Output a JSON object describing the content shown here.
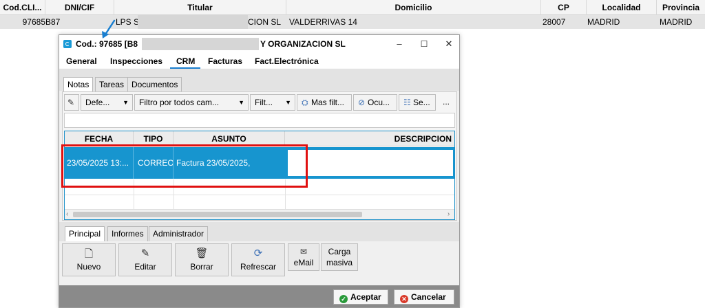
{
  "background": {
    "columns": [
      "Cod.CLI...",
      "DNI/CIF",
      "Titular",
      "Domicilio",
      "CP",
      "Localidad",
      "Provincia"
    ],
    "row": {
      "cod": "97685",
      "dni": "B87",
      "titular_left": "LPS S",
      "titular_right": "CION SL",
      "domicilio": "VALDERRIVAS 14",
      "cp": "28007",
      "localidad": "MADRID",
      "provincia": "MADRID"
    }
  },
  "dialog": {
    "title_left": "Cod.: 97685 [B8",
    "title_right": "Y ORGANIZACION SL",
    "window_buttons": {
      "minimize": "–",
      "maximize": "☐",
      "close": "✕"
    },
    "main_tabs": [
      "General",
      "Inspecciones",
      "CRM",
      "Facturas",
      "Fact.Electrónica"
    ],
    "active_main_tab": "CRM",
    "sub_tabs": [
      "Notas",
      "Tareas",
      "Documentos"
    ],
    "active_sub_tab": "Notas",
    "toolbar": {
      "pin_icon": "pencil-icon",
      "view_select": "Defe...",
      "filter_select": "Filtro por todos cam...",
      "filt_select": "Filt...",
      "more_filters": "Mas filt...",
      "hide": "Ocu...",
      "select": "Se...",
      "overflow": "..."
    },
    "grid": {
      "headers": [
        "FECHA",
        "TIPO",
        "ASUNTO",
        "DESCRIPCION"
      ],
      "rows": [
        {
          "fecha": "23/05/2025 13:...",
          "tipo": "CORREO",
          "asunto": "Factura 23/05/2025,",
          "descripcion": ""
        }
      ]
    },
    "bottom_tabs": [
      "Principal",
      "Informes",
      "Administrador"
    ],
    "active_bottom_tab": "Principal",
    "actions": [
      {
        "label": "Nuevo",
        "icon": "new-document-icon",
        "glyph": "🗋"
      },
      {
        "label": "Editar",
        "icon": "edit-icon",
        "glyph": "✎"
      },
      {
        "label": "Borrar",
        "icon": "trash-icon",
        "glyph": "🗑"
      },
      {
        "label": "Refrescar",
        "icon": "refresh-icon",
        "glyph": "⟳"
      },
      {
        "label": "eMail",
        "icon": "email-icon",
        "glyph": "✉"
      },
      {
        "label_line1": "Carga",
        "label_line2": "masiva"
      }
    ],
    "footer": {
      "accept": "Aceptar",
      "cancel": "Cancelar"
    }
  },
  "colors": {
    "selection": "#1795cf",
    "accent": "#1a7fd0",
    "highlight": "#e01010",
    "footer_bg": "#8a8a8a"
  }
}
